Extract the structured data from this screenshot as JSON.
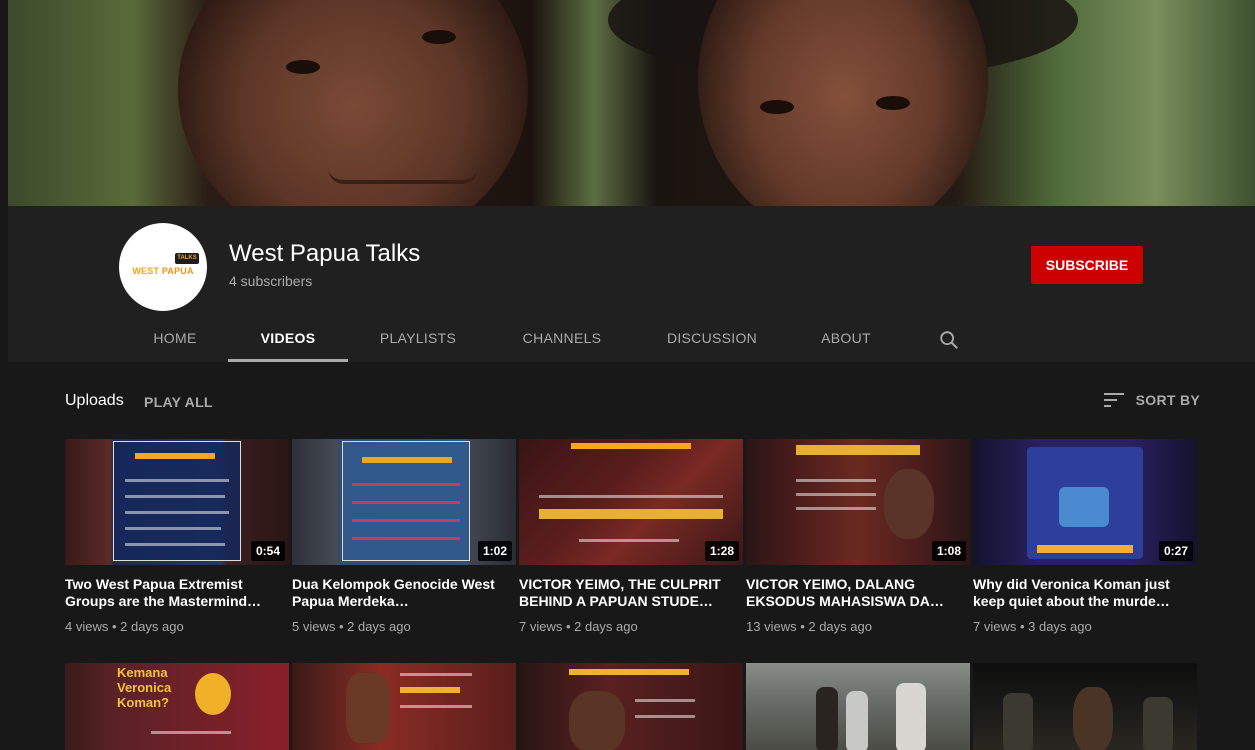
{
  "channel": {
    "name": "West Papua Talks",
    "subscribers": "4 subscribers",
    "subscribe_label": "SUBSCRIBE",
    "avatar_badge": "TALKS",
    "avatar_text_light": "WEST ",
    "avatar_text_bold": "PAPUA"
  },
  "tabs": [
    "HOME",
    "VIDEOS",
    "PLAYLISTS",
    "CHANNELS",
    "DISCUSSION",
    "ABOUT"
  ],
  "active_tab": "VIDEOS",
  "section": {
    "title": "Uploads",
    "play_all": "PLAY ALL",
    "sort_by": "SORT BY"
  },
  "videos": [
    {
      "title": "Two West Papua Extremist Groups are the Mastermind…",
      "duration": "0:54",
      "meta": "4 views • 2 days ago"
    },
    {
      "title": "Dua Kelompok Genocide West Papua Merdeka…",
      "duration": "1:02",
      "meta": "5 views • 2 days ago"
    },
    {
      "title": "VICTOR YEIMO, THE CULPRIT BEHIND A PAPUAN STUDE…",
      "duration": "1:28",
      "meta": "7 views • 2 days ago"
    },
    {
      "title": "VICTOR YEIMO, DALANG EKSODUS MAHASISWA DA…",
      "duration": "1:08",
      "meta": "13 views • 2 days ago"
    },
    {
      "title": "Why did Veronica Koman just keep quiet about the murde…",
      "duration": "0:27",
      "meta": "7 views • 3 days ago"
    }
  ],
  "row2_thumbs": [
    {
      "text": "Kemana Veronica Koman?"
    },
    {
      "text": ""
    },
    {
      "text": ""
    },
    {
      "text": ""
    },
    {
      "text": ""
    }
  ],
  "colors": {
    "background": "#181818",
    "header": "#202020",
    "subscribe": "#cc0000",
    "accent": "#f5a623"
  }
}
